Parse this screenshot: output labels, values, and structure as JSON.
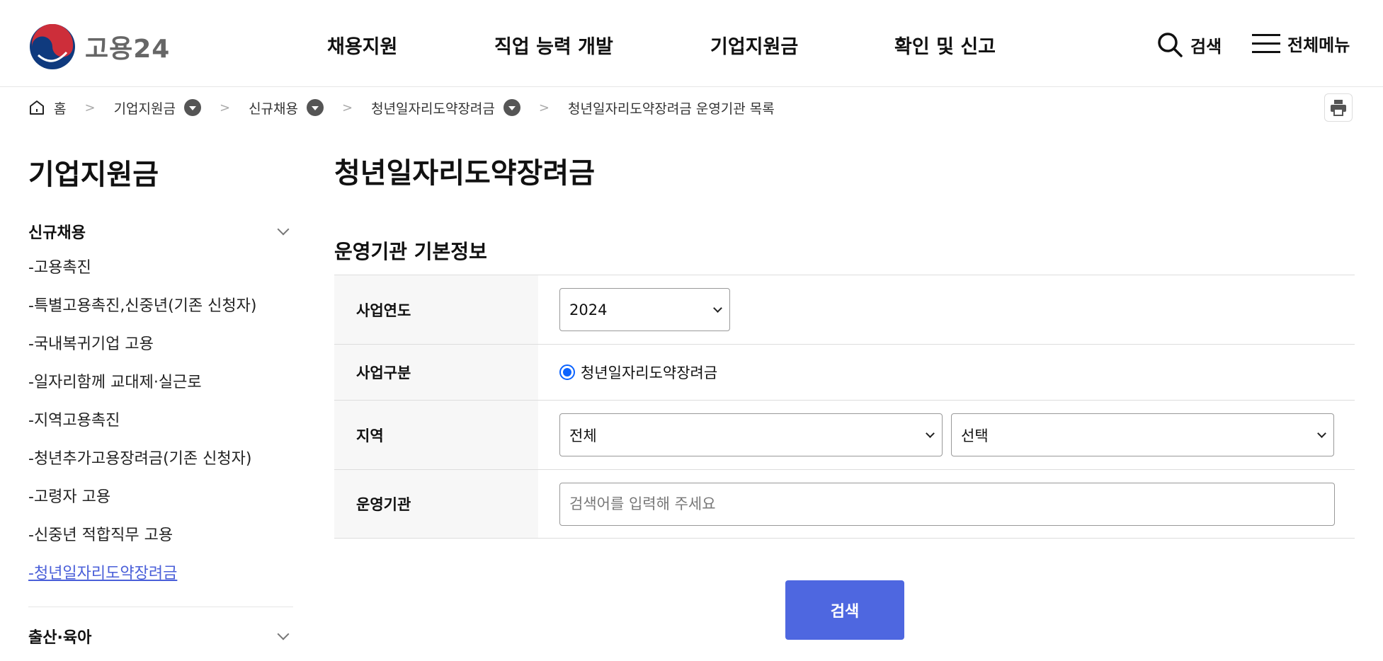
{
  "header": {
    "logo_text": "고용24",
    "nav": [
      "채용지원",
      "직업 능력 개발",
      "기업지원금",
      "확인 및 신고"
    ],
    "search_label": "검색",
    "menu_label": "전체메뉴"
  },
  "breadcrumb": {
    "home": "홈",
    "items": [
      "기업지원금",
      "신규채용",
      "청년일자리도약장려금",
      "청년일자리도약장려금 운영기관 목록"
    ]
  },
  "sidebar": {
    "title": "기업지원금",
    "group1": "신규채용",
    "items": [
      "-고용촉진",
      "-특별고용촉진,신중년(기존 신청자)",
      "-국내복귀기업 고용",
      "-일자리함께 교대제·실근로",
      "-지역고용촉진",
      "-청년추가고용장려금(기존 신청자)",
      "-고령자 고용",
      "-신중년 적합직무 고용"
    ],
    "active_prefix": "-",
    "active_item": "청년일자리도약장려금",
    "group2": "출산·육아"
  },
  "main": {
    "page_title": "청년일자리도약장려금",
    "section_title": "운영기관 기본정보",
    "form": {
      "year_label": "사업연도",
      "year_value": "2024",
      "type_label": "사업구분",
      "type_option": "청년일자리도약장려금",
      "region_label": "지역",
      "region1_value": "전체",
      "region2_value": "선택",
      "org_label": "운영기관",
      "org_placeholder": "검색어를 입력해 주세요"
    },
    "search_button": "검색"
  },
  "colors": {
    "accent": "#4e67e0",
    "active_link": "#4a5fd9",
    "radio": "#0b63ff",
    "logo_red": "#cd2e3a",
    "logo_blue": "#0f3a7e"
  }
}
